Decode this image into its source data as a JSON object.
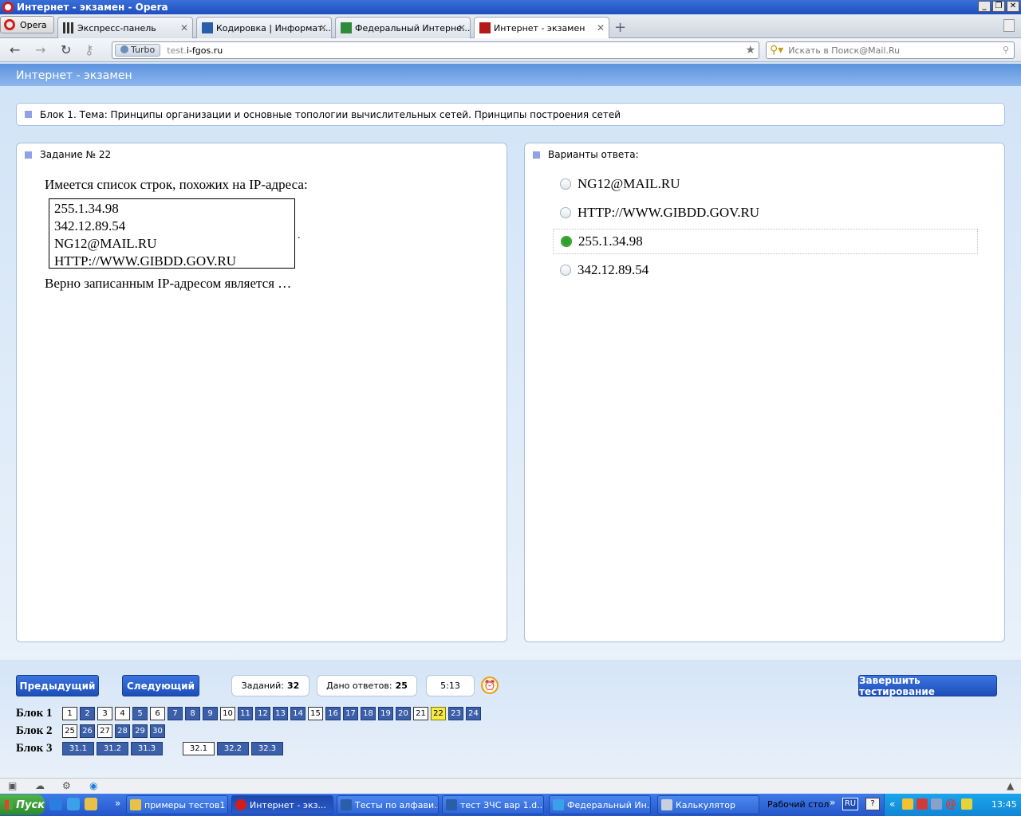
{
  "window": {
    "title": "Интернет - экзамен - Opera"
  },
  "browser": {
    "menu_label": "Opera",
    "tabs": [
      {
        "label": "Экспресс-панель"
      },
      {
        "label": "Кодировка | Информат..."
      },
      {
        "label": "Федеральный Интерне..."
      },
      {
        "label": "Интернет - экзамен"
      }
    ],
    "turbo_label": "Turbo",
    "url_host": "test.",
    "url_domain": "i-fgos.ru",
    "search_placeholder": "Искать в Поиск@Mail.Ru"
  },
  "page": {
    "header": "Интернет - экзамен",
    "topic": "Блок 1. Тема: Принципы организации и основные топологии вычислительных сетей. Принципы построения сетей",
    "task": {
      "title": "Задание № 22",
      "intro": "Имеется список строк, похожих на IP-адреса:",
      "list": [
        "255.1.34.98",
        "342.12.89.54",
        "NG12@MAIL.RU",
        "HTTP://WWW.GIBDD.GOV.RU"
      ],
      "after_dot": ".",
      "question": "Верно записанным IP-адресом является …"
    },
    "answers": {
      "title": "Варианты ответа:",
      "options": [
        {
          "label": "NG12@MAIL.RU",
          "selected": false
        },
        {
          "label": "HTTP://WWW.GIBDD.GOV.RU",
          "selected": false
        },
        {
          "label": "255.1.34.98",
          "selected": true
        },
        {
          "label": "342.12.89.54",
          "selected": false
        }
      ]
    }
  },
  "controls": {
    "prev_label": "Предыдущий",
    "next_label": "Следующий",
    "tasks_label": "Заданий:",
    "tasks_count": "32",
    "answered_label": "Дано ответов:",
    "answered_count": "25",
    "timer": "5:13",
    "finish_label": "Завершить тестирование"
  },
  "blocks": [
    {
      "label": "Блок 1",
      "items": [
        {
          "n": "1",
          "s": "ans"
        },
        {
          "n": "2",
          "s": "done"
        },
        {
          "n": "3",
          "s": "ans"
        },
        {
          "n": "4",
          "s": "ans"
        },
        {
          "n": "5",
          "s": "done"
        },
        {
          "n": "6",
          "s": "ans"
        },
        {
          "n": "7",
          "s": "done"
        },
        {
          "n": "8",
          "s": "done"
        },
        {
          "n": "9",
          "s": "done"
        },
        {
          "n": "10",
          "s": "ans"
        },
        {
          "n": "11",
          "s": "done"
        },
        {
          "n": "12",
          "s": "done"
        },
        {
          "n": "13",
          "s": "done"
        },
        {
          "n": "14",
          "s": "done"
        },
        {
          "n": "15",
          "s": "ans"
        },
        {
          "n": "16",
          "s": "done"
        },
        {
          "n": "17",
          "s": "done"
        },
        {
          "n": "18",
          "s": "done"
        },
        {
          "n": "19",
          "s": "done"
        },
        {
          "n": "20",
          "s": "done"
        },
        {
          "n": "21",
          "s": "ans"
        },
        {
          "n": "22",
          "s": "cur"
        },
        {
          "n": "23",
          "s": "done"
        },
        {
          "n": "24",
          "s": "done"
        }
      ]
    },
    {
      "label": "Блок 2",
      "items": [
        {
          "n": "25",
          "s": "ans"
        },
        {
          "n": "26",
          "s": "done"
        },
        {
          "n": "27",
          "s": "ans"
        },
        {
          "n": "28",
          "s": "done"
        },
        {
          "n": "29",
          "s": "done"
        },
        {
          "n": "30",
          "s": "done"
        }
      ]
    },
    {
      "label": "Блок 3",
      "items": [
        {
          "n": "31.1",
          "s": "done"
        },
        {
          "n": "31.2",
          "s": "done"
        },
        {
          "n": "31.3",
          "s": "done"
        },
        {
          "n": "32.1",
          "s": "ans"
        },
        {
          "n": "32.2",
          "s": "done"
        },
        {
          "n": "32.3",
          "s": "done"
        }
      ]
    }
  ],
  "taskbar": {
    "start_label": "Пуск",
    "items": [
      {
        "label": "примеры тестов1"
      },
      {
        "label": "Интернет - экз..."
      },
      {
        "label": "Тесты по алфави..."
      },
      {
        "label": "тест ЗЧС вар 1.d..."
      },
      {
        "label": "Федеральный Ин..."
      },
      {
        "label": "Калькулятор"
      }
    ],
    "desktop_label": "Рабочий стол",
    "lang": "RU",
    "time": "13:45"
  }
}
